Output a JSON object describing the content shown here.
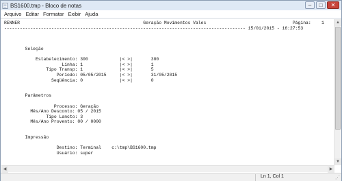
{
  "window": {
    "title": "BS1600.tmp - Bloco de notas",
    "minimize_icon": "minimize-icon",
    "maximize_icon": "maximize-icon",
    "close_icon": "close-icon",
    "app_icon": "notepad-icon"
  },
  "menu": {
    "items": [
      "Arquivo",
      "Editar",
      "Formatar",
      "Exibir",
      "Ajuda"
    ]
  },
  "document": {
    "lines": [
      "RENNER                                               Geração Movimentos Vales                                 Página:    1",
      "-------------------------------------------------------------------------------------------- 15/01/2015 - 16:27:53",
      "",
      "",
      "",
      "        Seleção",
      "",
      "            Estabelecimento: 300            |< >|       300",
      "                      Linha: 1              |< >|       1",
      "                Tipo Transp: 1              |< >|       5",
      "                    Período: 05/05/2015     |< >|       31/05/2015",
      "                  Seqüência: 0              |< >|       0",
      "",
      "",
      "        Parâmetros",
      "",
      "                   Processo: Geração",
      "          Mês/Ano Desconto: 05 / 2015",
      "                Tipo Lancto: 3",
      "          Mês/Ano Provento: 00 / 0000",
      "",
      "",
      "        Impressão",
      "",
      "                    Destino: Terminal    c:\\tmp\\BS1600.tmp",
      "                    Usuário: super",
      "",
      ""
    ]
  },
  "status": {
    "position": "Ln 1, Col 1"
  }
}
